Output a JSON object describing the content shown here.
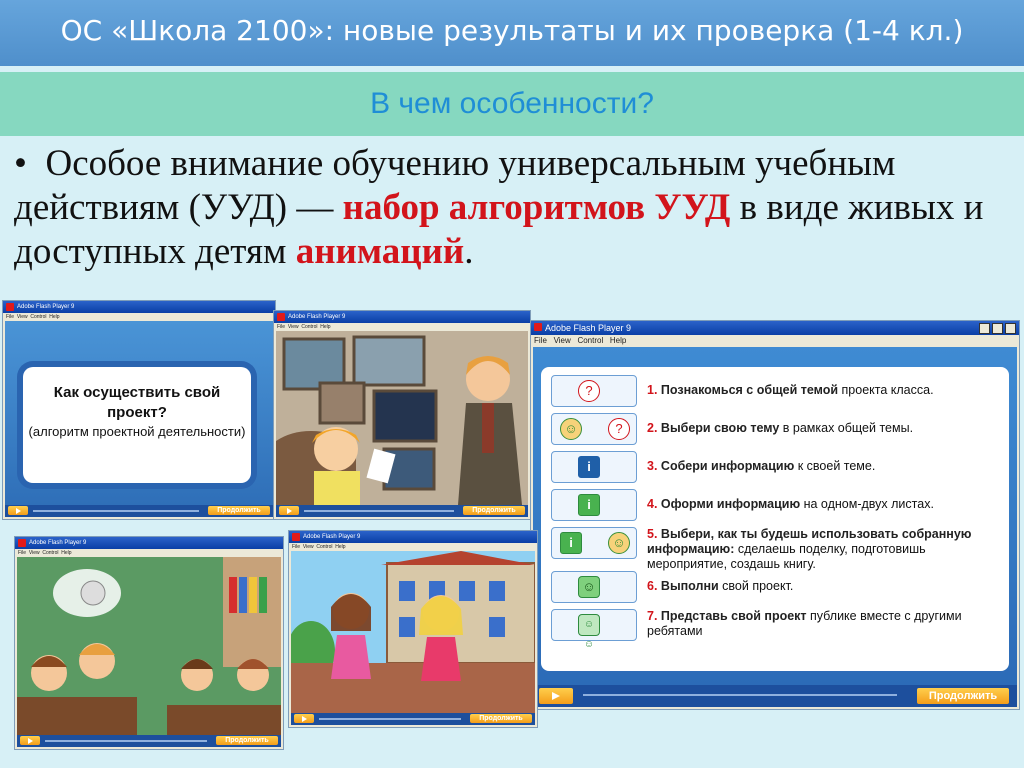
{
  "header": {
    "title": "ОС «Школа 2100»: новые результаты и их проверка (1-4 кл.)"
  },
  "subheader": {
    "title": "В чем особенности?"
  },
  "bullet": {
    "marker": "•",
    "part1": "Особое внимание обучению универсальным учебным действиям (УУД) — ",
    "highlight1": "набор алгоритмов УУД",
    "part2": " в виде живых и доступных детям ",
    "highlight2": "анимаций",
    "part3": "."
  },
  "colors": {
    "header": "#5596d0",
    "subheader": "#86d8c0",
    "highlight": "#d2141b",
    "background": "#d7f0f6"
  },
  "flash": {
    "title": "Adobe Flash Player 9",
    "menu": [
      "File",
      "View",
      "Control",
      "Help"
    ],
    "continue": "Продолжить"
  },
  "card": {
    "question": "Как осуществить свой проект?",
    "note": "(алгоритм проектной деятельности)"
  },
  "steps": [
    {
      "num": "1.",
      "bold": "Познакомься с общей темой",
      "rest": " проекта класса.",
      "icon": "question-icon"
    },
    {
      "num": "2.",
      "bold": "Выбери свою тему",
      "rest": " в рамках общей темы.",
      "icon": "face-question-icon"
    },
    {
      "num": "3.",
      "bold": "Собери информацию",
      "rest": " к своей теме.",
      "icon": "info-icon"
    },
    {
      "num": "4.",
      "bold": "Оформи информацию",
      "rest": " на одном-двух листах.",
      "icon": "info-stack-icon"
    },
    {
      "num": "5.",
      "bold": "Выбери, как ты будешь использовать собранную информацию:",
      "rest": " сделаешь поделку, подготовишь мероприятие, создашь книгу.",
      "icon": "info-to-face-icon"
    },
    {
      "num": "6.",
      "bold": "Выполни",
      "rest": " свой проект.",
      "icon": "face-icon"
    },
    {
      "num": "7.",
      "bold": "Представь свой проект",
      "rest": " публике вместе с другими ребятами",
      "icon": "group-icon"
    }
  ]
}
